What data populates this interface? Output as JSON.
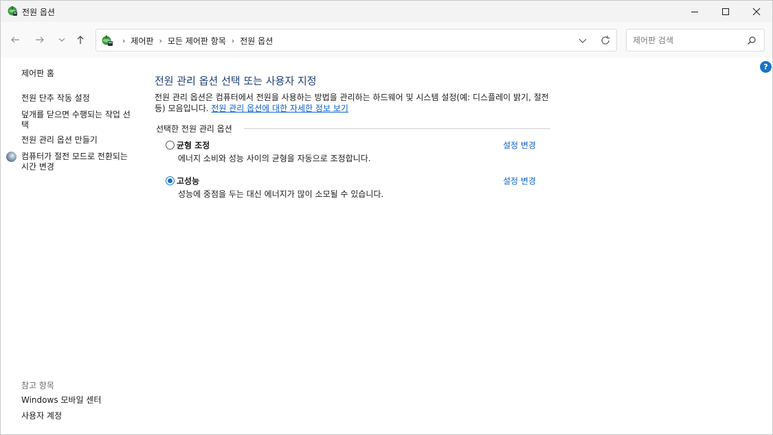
{
  "window": {
    "title": "전원 옵션",
    "icon": "power-options-icon"
  },
  "navigation": {
    "breadcrumbs": [
      "제어판",
      "모든 제어판 항목",
      "전원 옵션"
    ],
    "search_placeholder": "제어판 검색"
  },
  "left_pane": {
    "home": "제어판 홈",
    "links": [
      "전원 단추 작동 설정",
      "덮개를 닫으면 수행되는 작업 선택",
      "전원 관리 옵션 만들기",
      "컴퓨터가 절전 모드로 전환되는 시간 변경"
    ],
    "see_also_heading": "참고 항목",
    "see_also": [
      "Windows 모바일 센터",
      "사용자 계정"
    ]
  },
  "main": {
    "title": "전원 관리 옵션 선택 또는 사용자 지정",
    "description": "전원 관리 옵션은 컴퓨터에서 전원을 사용하는 방법을 관리하는 하드웨어 및 시스템 설정(예: 디스플레이 밝기, 절전 등) 모음입니다. ",
    "description_link": "전원 관리 옵션에 대한 자세한 정보 보기",
    "section_label": "선택한 전원 관리 옵션",
    "plans": [
      {
        "name": "균형 조정",
        "description": "에너지 소비와 성능 사이의 균형을 자동으로 조정합니다.",
        "link": "설정 변경",
        "selected": false
      },
      {
        "name": "고성능",
        "description": "성능에 중점을 두는 대신 에너지가 많이 소모될 수 있습니다.",
        "link": "설정 변경",
        "selected": true
      }
    ]
  },
  "colors": {
    "title_blue": "#1e3c78",
    "link_blue": "#0a60c8",
    "radio_blue": "#1a6fc4"
  }
}
